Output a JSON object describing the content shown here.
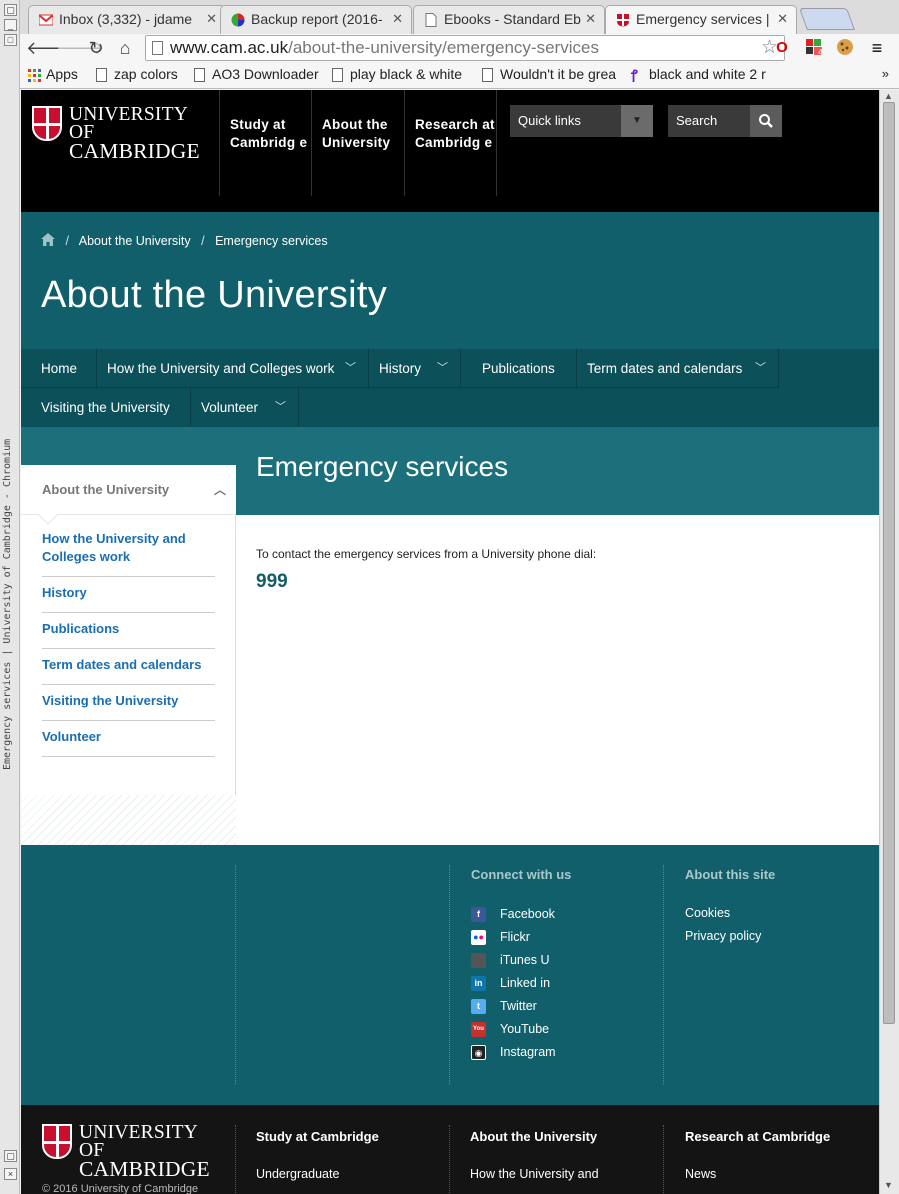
{
  "window": {
    "title": "Emergency services | University of Cambridge - Chromium"
  },
  "tabs": [
    {
      "label": "Inbox (3,332) - jdame",
      "icon": "gmail-icon"
    },
    {
      "label": "Backup report (2016-",
      "icon": "globe-icon"
    },
    {
      "label": "Ebooks - Standard Eb",
      "icon": "page-icon"
    },
    {
      "label": "Emergency services |",
      "icon": "cambridge-crest-icon"
    }
  ],
  "omnibox": {
    "host": "www.cam.ac.uk",
    "path": "/about-the-university/emergency-services"
  },
  "extensions": {
    "badge": "4"
  },
  "bookmarks": [
    {
      "label": "Apps"
    },
    {
      "label": "zap colors"
    },
    {
      "label": "AO3 Downloader"
    },
    {
      "label": "play black & white"
    },
    {
      "label": "Wouldn't it be grea"
    },
    {
      "label": "black and white 2 r"
    }
  ],
  "bookmarks_more": "»",
  "header": {
    "logo_line1": "UNIVERSITY OF",
    "logo_line2": "CAMBRIDGE",
    "nav": [
      {
        "label": "Study at Cambridg e"
      },
      {
        "label": "About the University"
      },
      {
        "label": "Research at Cambridg e"
      }
    ],
    "quick_links": "Quick links",
    "search_placeholder": "Search"
  },
  "breadcrumb": {
    "items": [
      "About the University",
      "Emergency services"
    ],
    "separator": "/"
  },
  "hero_title": "About the University",
  "subnav": [
    {
      "label": "Home"
    },
    {
      "label": "How the University and Colleges work"
    },
    {
      "label": "History"
    },
    {
      "label": "Publications"
    },
    {
      "label": "Term dates and calendars"
    },
    {
      "label": "Visiting the University"
    },
    {
      "label": "Volunteer"
    }
  ],
  "section_title": "Emergency services",
  "sidebar": {
    "heading": "About the University",
    "items": [
      {
        "label": "How the University and Colleges work"
      },
      {
        "label": "History"
      },
      {
        "label": "Publications"
      },
      {
        "label": "Term dates and calendars"
      },
      {
        "label": "Visiting the University"
      },
      {
        "label": "Volunteer"
      }
    ]
  },
  "content": {
    "instruction": "To contact the emergency services from a University phone dial:",
    "phone": "999"
  },
  "footer": {
    "connect_heading": "Connect with us",
    "social": [
      {
        "label": "Facebook",
        "icon": "facebook-icon",
        "color": "#3b5998"
      },
      {
        "label": "Flickr",
        "icon": "flickr-icon",
        "color": "#ffffff"
      },
      {
        "label": "iTunes U",
        "icon": "apple-icon",
        "color": "#555555"
      },
      {
        "label": "Linked in",
        "icon": "linkedin-icon",
        "color": "#0e76a8"
      },
      {
        "label": "Twitter",
        "icon": "twitter-icon",
        "color": "#55acee"
      },
      {
        "label": "YouTube",
        "icon": "youtube-icon",
        "color": "#c4302b"
      },
      {
        "label": "Instagram",
        "icon": "instagram-icon",
        "color": "#222222"
      }
    ],
    "site_heading": "About this site",
    "site_links": [
      {
        "label": "Cookies"
      },
      {
        "label": "Privacy policy"
      }
    ]
  },
  "footer2": {
    "logo_line1": "UNIVERSITY OF",
    "logo_line2": "CAMBRIDGE",
    "columns": [
      {
        "heading": "Study at Cambridge",
        "first_link": "Undergraduate"
      },
      {
        "heading": "About the University",
        "first_link": "How the University and"
      },
      {
        "heading": "Research at Cambridge",
        "first_link": "News"
      }
    ],
    "copyright": "© 2016 University of Cambridge"
  },
  "colors": {
    "teal_dark": "#105f6b",
    "teal_band": "#1c707c",
    "link_blue": "#1a6eb2",
    "header_black": "#000000"
  }
}
